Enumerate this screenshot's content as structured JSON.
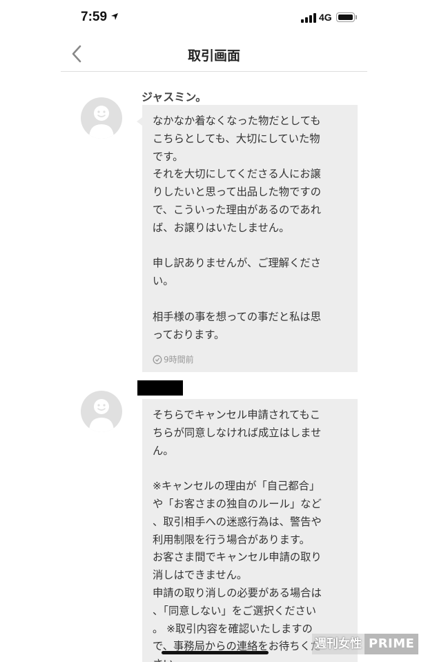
{
  "status_bar": {
    "time": "7:59",
    "network": "4G",
    "battery_level": 1.0
  },
  "nav": {
    "back_icon": "chevron-left-icon",
    "title": "取引画面"
  },
  "messages": [
    {
      "sender": "ジャスミン。",
      "avatar_icon": "default-avatar-icon",
      "text": "なかなか着なくなった物だとしても\nこちらとしても、大切にしていた物\nです。\nそれを大切にしてくださる人にお譲\nりしたいと思って出品した物ですの\nで、こういった理由があるのであれ\nば、お譲りはいたしません。\n\n申し訳ありませんが、ご理解くださ\nい。\n\n相手様の事を想っての事だと私は思\nっております。",
      "time_icon": "clock-icon",
      "time": "9時間前"
    },
    {
      "sender_redacted": true,
      "avatar_icon": "default-avatar-icon",
      "text": "そちらでキャンセル申請されてもこ\nちらが同意しなければ成立はしませ\nん。\n\n※キャンセルの理由が「自己都合」\nや「お客さまの独自のルール」など\n、取引相手への迷惑行為は、警告や\n利用制限を行う場合があります。\nお客さま間でキャンセル申請の取り\n消しはできません。\n申請の取り消しの必要がある場合は\n、「同意しない」をご選択ください\n。 ※取引内容を確認いたしますの\nで、事務局からの連絡をお待ちくだ\nさい"
    }
  ],
  "watermark": {
    "left": "週刊女性",
    "right": "PRIME"
  }
}
